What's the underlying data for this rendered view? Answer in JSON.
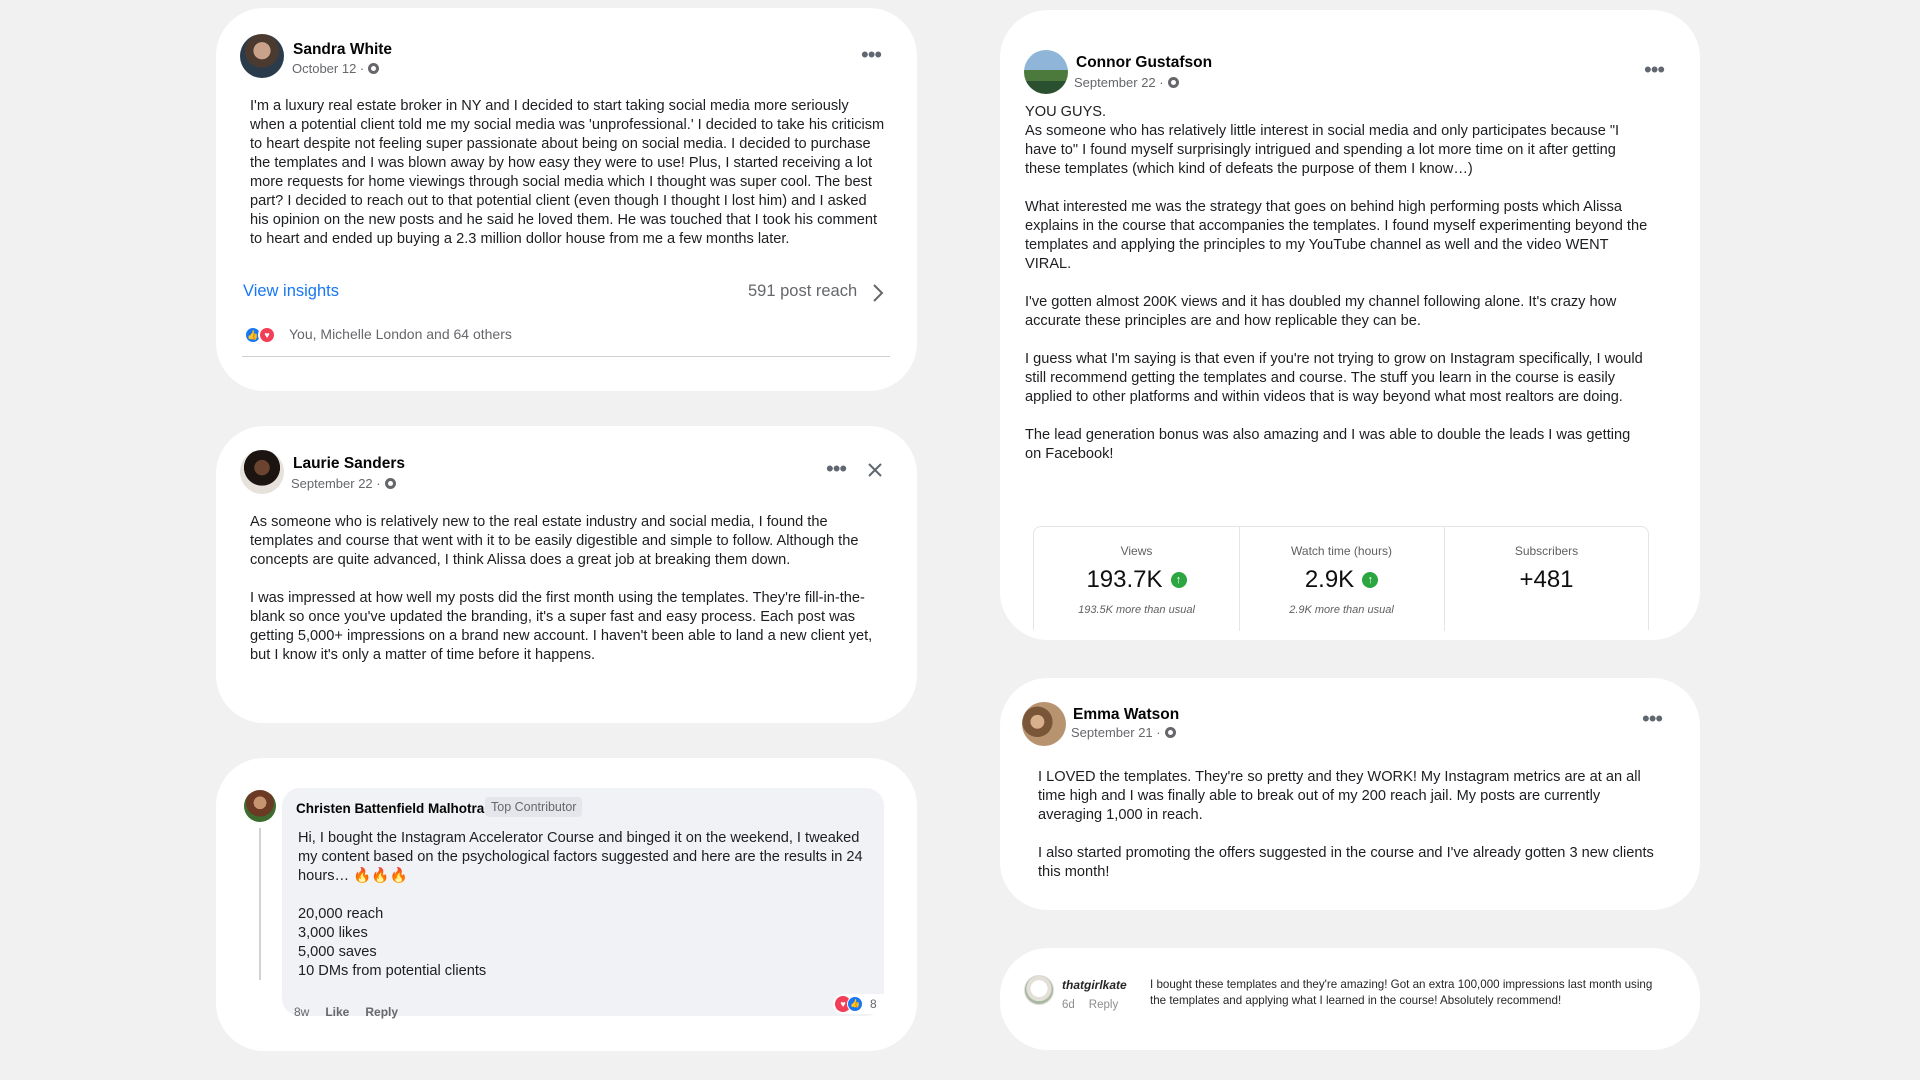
{
  "posts": {
    "sandra": {
      "name": "Sandra White",
      "date": "October 12 · ",
      "body": "I'm a luxury real estate broker in NY and I decided to start taking social media more seriously when a potential client told me my social media was 'unprofessional.' I decided to take his criticism to heart despite not feeling super passionate about being on social media. I decided to purchase the templates and I was blown away by how easy they were to use! Plus, I started receiving a lot more requests for home viewings through social media which I thought was super cool. The best part? I decided to reach out to that potential client (even though I thought I lost him) and I asked his opinion on the new posts and he said he loved them. He was touched that I took his comment to heart and ended up buying a 2.3 million dollor house from me a few months later.",
      "view_insights": "View insights",
      "post_reach": "591 post reach",
      "reactions": "You, Michelle London and 64 others"
    },
    "laurie": {
      "name": "Laurie Sanders",
      "date": "September 22 · ",
      "paragraphs": [
        "As someone who is relatively new to the real estate industry and social media, I found the templates and course that went with it to be easily digestible and simple to follow. Although the concepts are quite advanced, I think Alissa does a great job at breaking them down.",
        "I was impressed at how well my posts did the first month using the templates. They're fill-in-the-blank so once you've updated the branding, it's a super fast and easy process. Each post was getting 5,000+ impressions on a brand new account. I haven't been able to land a new client yet, but I know it's only a matter of time before it happens."
      ]
    },
    "christen": {
      "name": "Christen Battenfield Malhotra",
      "badge": "Top Contributor",
      "intro": "Hi, I bought the Instagram Accelerator Course and binged it on the weekend, I tweaked my content based on the psychological factors suggested and here are the results in 24 hours… 🔥🔥🔥",
      "results": [
        "20,000 reach",
        "3,000 likes",
        "5,000 saves",
        "10 DMs from potential clients"
      ],
      "time": "8w",
      "like": "Like",
      "reply": "Reply",
      "reaction_count": "8"
    },
    "connor": {
      "name": "Connor Gustafson",
      "date": "September 22 · ",
      "paragraphs": [
        "YOU GUYS.\nAs someone who has relatively little interest in social media and only participates because \"I have to\" I found myself surprisingly intrigued and spending a lot more time on it after getting these templates (which kind of defeats the purpose of them I know…)",
        "What interested me was the strategy that goes on behind high performing posts which Alissa explains in the course that accompanies the templates. I found myself experimenting beyond the templates and applying the principles to my YouTube channel as well and the video WENT VIRAL.",
        "I've gotten almost 200K views and it has doubled my channel following alone. It's crazy how accurate these principles are and how replicable they can be.",
        "I guess what I'm saying is that even if you're not trying to grow on Instagram specifically, I would still recommend getting the templates and course. The stuff you learn in the course is easily applied to other platforms and within videos that is way beyond what most realtors are doing.",
        "The lead generation bonus was also amazing and I was able to double the leads I was getting on Facebook!"
      ],
      "stats": [
        {
          "label": "Views",
          "value": "193.7K",
          "sub": "193.5K more than usual"
        },
        {
          "label": "Watch time (hours)",
          "value": "2.9K",
          "sub": "2.9K more than usual"
        },
        {
          "label": "Subscribers",
          "value": "+481",
          "sub": ""
        }
      ]
    },
    "emma": {
      "name": "Emma Watson",
      "date": "September 21 · ",
      "paragraphs": [
        "I LOVED the templates. They're so pretty and they WORK! My Instagram metrics are at an all time high and I was finally able to break out of my 200 reach jail. My posts are currently averaging 1,000 in reach.",
        "I also started promoting the offers suggested in the course and I've already gotten 3 new clients this month!"
      ]
    },
    "kate": {
      "name": "thatgirlkate",
      "body": "I bought these templates and they're amazing! Got an extra 100,000 impressions last month using the templates and applying what I learned in the course! Absolutely recommend!",
      "time": "6d",
      "reply": "Reply"
    }
  },
  "icons": {
    "more": "more-horizontal-icon",
    "close": "close-icon",
    "chevron": "chevron-right-icon",
    "globe": "globe-icon",
    "up": "arrow-up-circle-icon"
  },
  "colors": {
    "link": "#1877f2",
    "background": "#f1f1f1",
    "positive": "#2ba640",
    "comment_bubble": "#f0f2f5"
  }
}
